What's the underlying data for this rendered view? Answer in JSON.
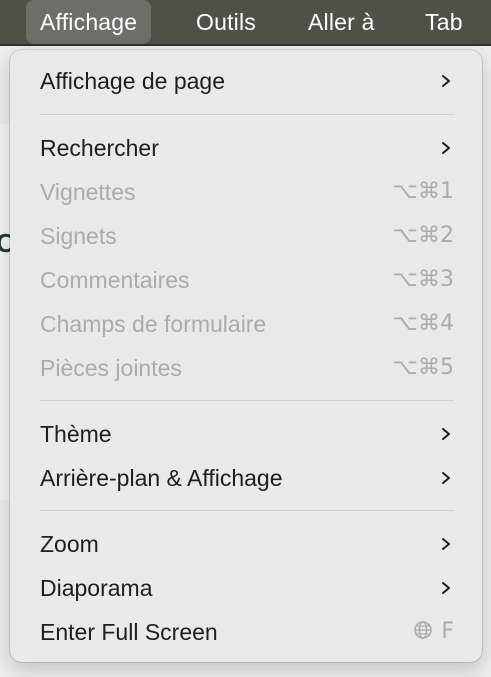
{
  "menubar": {
    "items": [
      {
        "label": "Affichage",
        "active": true
      },
      {
        "label": "Outils"
      },
      {
        "label": "Aller à"
      },
      {
        "label": "Tab"
      }
    ]
  },
  "menu": {
    "items": [
      {
        "label": "Affichage de page",
        "enabled": true,
        "submenu": true
      },
      {
        "label": "Rechercher",
        "enabled": true,
        "submenu": true
      },
      {
        "label": "Vignettes",
        "enabled": false,
        "shortcut": "⌥⌘1"
      },
      {
        "label": "Signets",
        "enabled": false,
        "shortcut": "⌥⌘2"
      },
      {
        "label": "Commentaires",
        "enabled": false,
        "shortcut": "⌥⌘3"
      },
      {
        "label": "Champs de formulaire",
        "enabled": false,
        "shortcut": "⌥⌘4"
      },
      {
        "label": "Pièces jointes",
        "enabled": false,
        "shortcut": "⌥⌘5"
      },
      {
        "label": "Thème",
        "enabled": true,
        "submenu": true
      },
      {
        "label": "Arrière-plan & Affichage",
        "enabled": true,
        "submenu": true
      },
      {
        "label": "Zoom",
        "enabled": true,
        "submenu": true
      },
      {
        "label": "Diaporama",
        "enabled": true,
        "submenu": true
      },
      {
        "label": "Enter Full Screen",
        "enabled": true,
        "shortcut_key": "F",
        "shortcut_icon": "globe-icon"
      }
    ]
  },
  "colors": {
    "menubar_bg": "#4f5146",
    "menu_bg": "#e9e9e8",
    "enabled_text": "#1e1e1e",
    "disabled_text": "#ababab"
  }
}
